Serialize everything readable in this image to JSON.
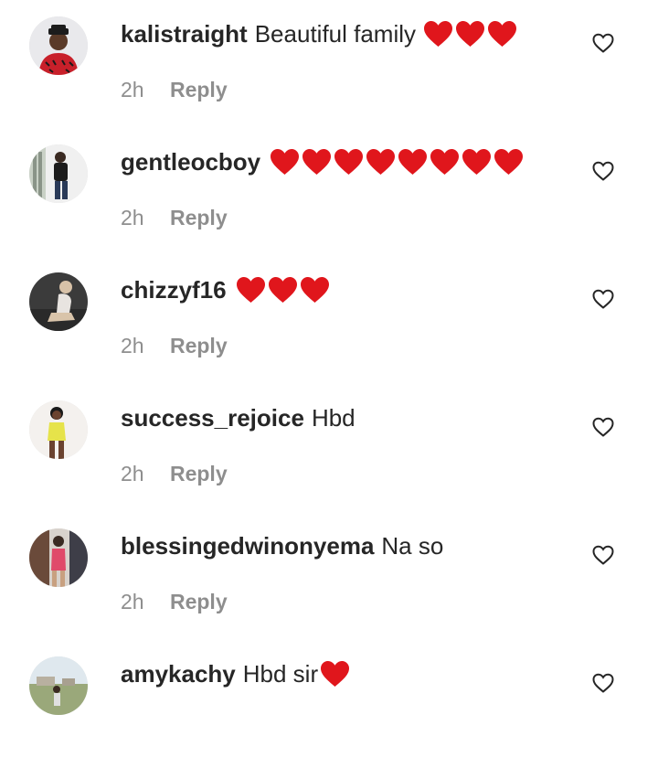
{
  "colors": {
    "username": "#262626",
    "text": "#262626",
    "meta": "#8e8e8e",
    "heart_emoji": "#e0161c",
    "background": "#ffffff"
  },
  "comments": [
    {
      "username": "kalistraight",
      "text": "Beautiful family",
      "hearts": 3,
      "time": "2h",
      "reply_label": "Reply",
      "avatar_icon": "avatar-man-red-shirt",
      "like_icon": "heart-outline-icon"
    },
    {
      "username": "gentleocboy",
      "text": "",
      "hearts": 8,
      "time": "2h",
      "reply_label": "Reply",
      "avatar_icon": "avatar-man-standing",
      "like_icon": "heart-outline-icon"
    },
    {
      "username": "chizzyf16",
      "text": "",
      "hearts": 3,
      "time": "2h",
      "reply_label": "Reply",
      "avatar_icon": "avatar-woman-sitting",
      "like_icon": "heart-outline-icon"
    },
    {
      "username": "success_rejoice",
      "text": "Hbd",
      "hearts": 0,
      "time": "2h",
      "reply_label": "Reply",
      "avatar_icon": "avatar-woman-yellow-dress",
      "like_icon": "heart-outline-icon"
    },
    {
      "username": "blessingedwinonyema",
      "text": "Na so",
      "hearts": 0,
      "time": "2h",
      "reply_label": "Reply",
      "avatar_icon": "avatar-woman-doorway",
      "like_icon": "heart-outline-icon"
    },
    {
      "username": "amykachy",
      "text": "Hbd sir",
      "hearts": 1,
      "time": "",
      "reply_label": "",
      "avatar_icon": "avatar-outdoor-scene",
      "like_icon": "heart-outline-icon"
    }
  ]
}
